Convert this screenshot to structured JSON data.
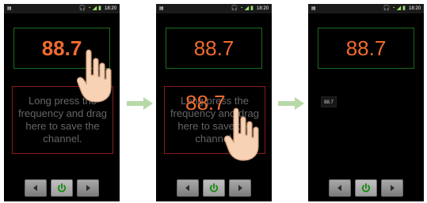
{
  "screens": [
    {
      "status_time": "18:20",
      "frequency": "88.7",
      "save_text": [
        "Long press the",
        "frequency and drag",
        "here to save the",
        "channel."
      ]
    },
    {
      "status_time": "18:20",
      "frequency": "88.7",
      "drag_frequency": "88.7",
      "save_text": [
        "Long press the",
        "frequency and drag",
        "here to save the",
        "channel."
      ]
    },
    {
      "status_time": "18:20",
      "frequency": "88.7",
      "saved_channel": "88.7"
    }
  ],
  "controls": {
    "previous_icon": "chevron-left-icon",
    "power_icon": "power-icon",
    "next_icon": "chevron-right-icon"
  },
  "colors": {
    "frequency": "#ef6b2f",
    "frequency_border": "#1d6b1d",
    "save_border": "#8a1b1b",
    "control_green": "#1e8d16",
    "arrow": "#b7d9a8"
  }
}
